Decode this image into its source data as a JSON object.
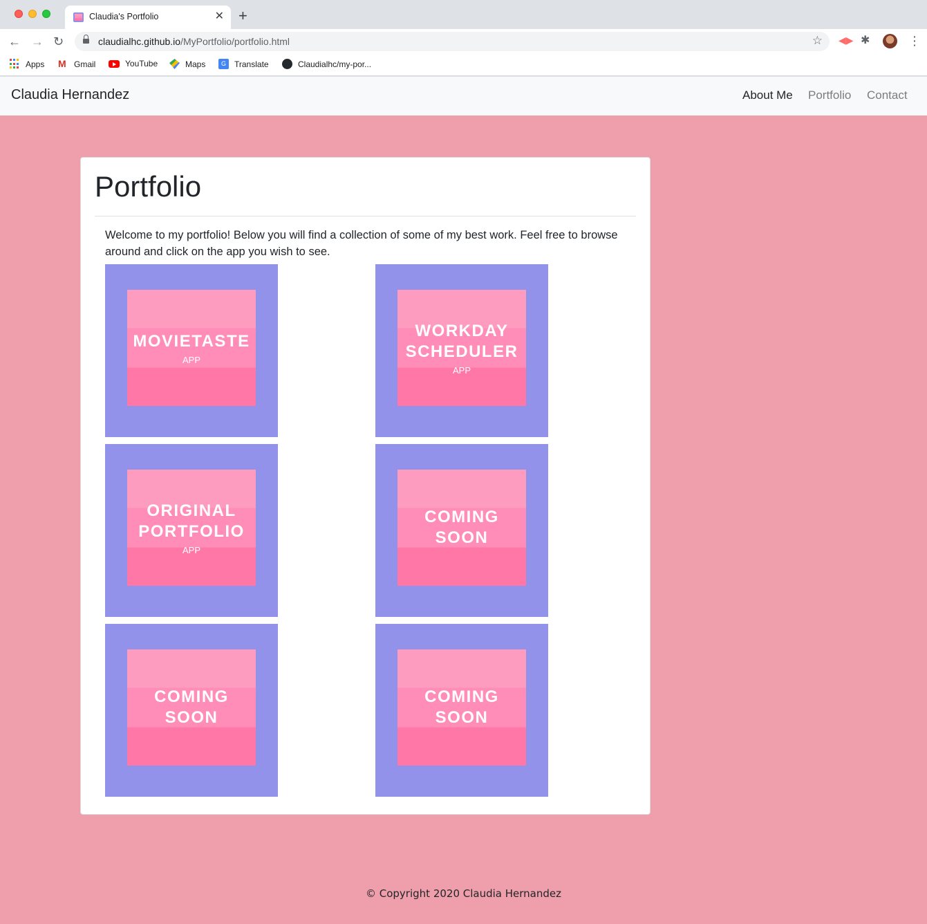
{
  "browser": {
    "tab_title": "Claudia's Portfolio",
    "tab_close": "✕",
    "new_tab": "+",
    "back": "←",
    "forward": "→",
    "reload": "↻",
    "url_host": "claudialhc.github.io",
    "url_path": "/MyPortfolio/portfolio.html",
    "star": "☆",
    "menu": "⋮",
    "bookmarks": [
      {
        "label": "Apps",
        "icon": "apps-grid-icon"
      },
      {
        "label": "Gmail",
        "icon": "gmail-icon"
      },
      {
        "label": "YouTube",
        "icon": "youtube-icon"
      },
      {
        "label": "Maps",
        "icon": "maps-icon"
      },
      {
        "label": "Translate",
        "icon": "translate-icon"
      },
      {
        "label": "Claudialhc/my-por...",
        "icon": "github-icon"
      }
    ]
  },
  "navbar": {
    "brand": "Claudia Hernandez",
    "links": [
      "About Me",
      "Portfolio",
      "Contact"
    ]
  },
  "main": {
    "title": "Portfolio",
    "intro": "Welcome to my portfolio! Below you will find a collection of some of my best work. Feel free to browse around and click on the app you wish to see.",
    "projects": [
      {
        "title": "MOVIETASTE",
        "subtitle": "APP"
      },
      {
        "title": "WORKDAY\nSCHEDULER",
        "subtitle": "APP"
      },
      {
        "title": "ORIGINAL\nPORTFOLIO",
        "subtitle": "APP"
      },
      {
        "title": "COMING\nSOON",
        "subtitle": ""
      },
      {
        "title": "COMING\nSOON",
        "subtitle": ""
      },
      {
        "title": "COMING\nSOON",
        "subtitle": ""
      }
    ]
  },
  "footer": {
    "copyright": "© Copyright 2020 Claudia Hernandez"
  },
  "colors": {
    "page_background": "#ef9fab",
    "tile_border": "#9292ea",
    "tile_pink_top": "#fe9cc0",
    "tile_pink_mid": "#ff8db8",
    "tile_pink_bottom": "#ff77a7"
  }
}
